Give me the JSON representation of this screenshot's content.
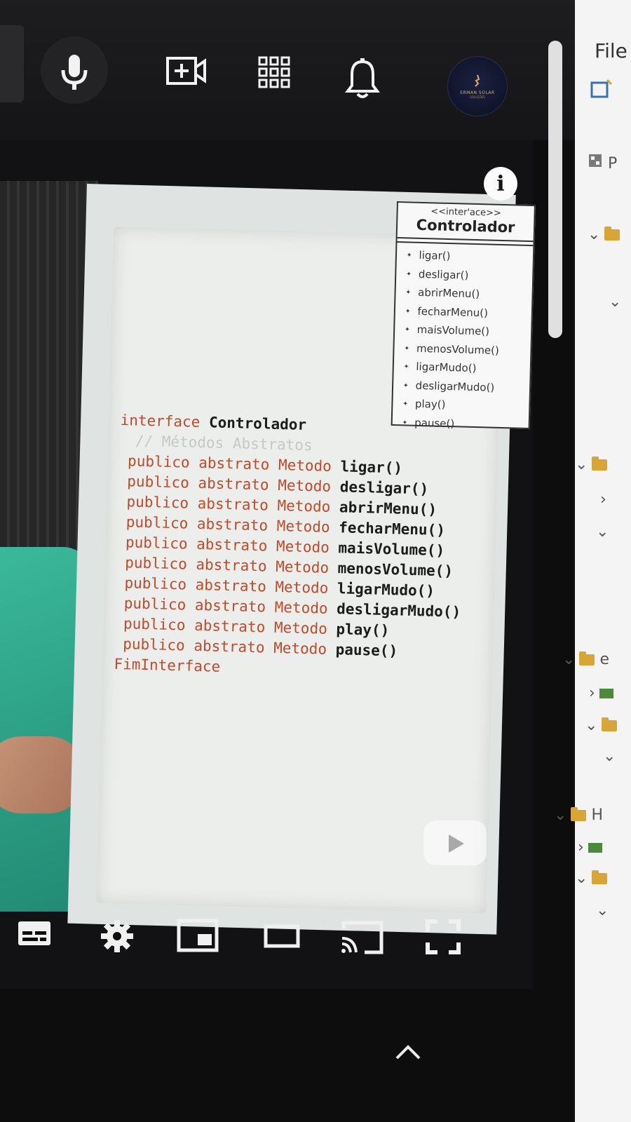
{
  "slide": {
    "uml": {
      "stereotype": "<<inter'ace>>",
      "class_name": "Controlador",
      "methods": [
        "ligar()",
        "desligar()",
        "abrirMenu()",
        "fecharMenu()",
        "maisVolume()",
        "menosVolume()",
        "ligarMudo()",
        "desligarMudo()",
        "play()",
        "pause()"
      ]
    },
    "code": {
      "header_kw": "interface",
      "header_name": "Controlador",
      "comment": "// Métodos Abstratos",
      "modifier_publico": "publico",
      "modifier_abstrato": "abstrato",
      "modifier_metodo": "Metodo",
      "methods": [
        "ligar()",
        "desligar()",
        "abrirMenu()",
        "fecharMenu()",
        "maisVolume()",
        "menosVolume()",
        "ligarMudo()",
        "desligarMudo()",
        "play()",
        "pause()"
      ],
      "footer": "FimInterface"
    },
    "info_label": "i"
  },
  "ide": {
    "menu_file": "File",
    "tab_letter": "P",
    "tree_letter_e": "e",
    "tree_letter_h": "H"
  },
  "avatar": {
    "brand_line1": "ERMAN SOLAR",
    "brand_line2": "SOLUÇÕES"
  }
}
